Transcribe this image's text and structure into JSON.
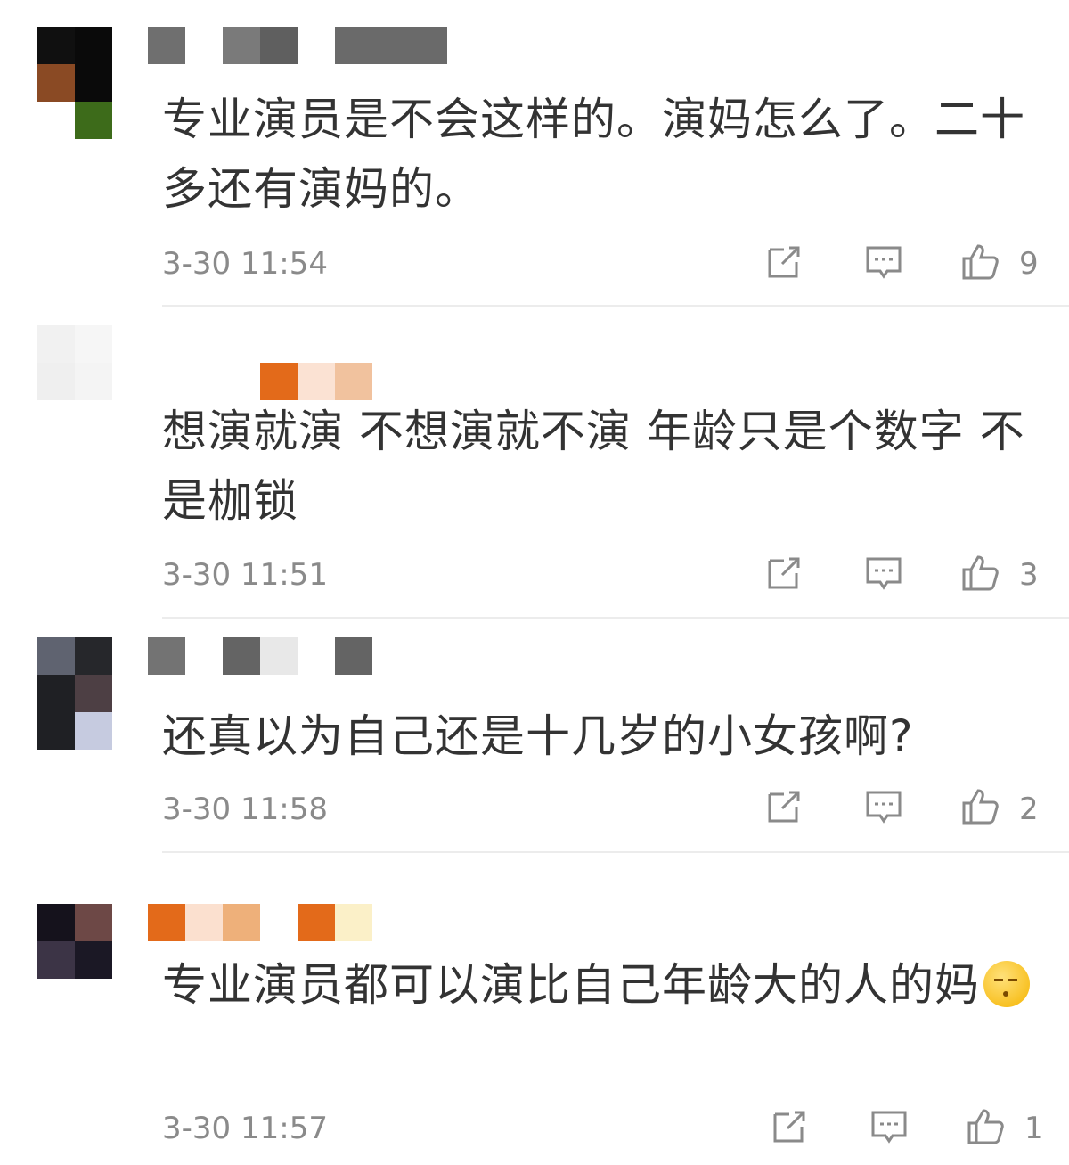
{
  "comments": [
    {
      "text": "专业演员是不会这样的。演妈怎么了。二十多还有演妈的。",
      "time": "3-30 11:54",
      "likes": "9",
      "avatar_colors": [
        "#101010",
        "#0a0a0a",
        "#8a4a24",
        "#3d6b1a"
      ],
      "username_colors": [
        "#6f6f6f",
        "#7a7a7a",
        "#5f5f5f",
        "#6a6a6a"
      ]
    },
    {
      "text": "想演就演 不想演就不演 年龄只是个数字 不是枷锁",
      "time": "3-30 11:51",
      "likes": "3",
      "avatar_colors": [
        "#f1f1f1",
        "#f6f6f6",
        "#efefef",
        "#f4f4f4"
      ],
      "username_colors": [
        "#e36a1a",
        "#fbe2d3",
        "#f1c29e"
      ]
    },
    {
      "text": "还真以为自己还是十几岁的小女孩啊?",
      "time": "3-30 11:58",
      "likes": "2",
      "avatar_colors": [
        "#5f6370",
        "#26272b",
        "#1f2024",
        "#4d3f44"
      ],
      "username_colors": [
        "#737373",
        "#646464",
        "#e8e8e8",
        "#646464"
      ]
    },
    {
      "text": "专业演员都可以演比自己年龄大的人的妈",
      "time": "3-30 11:57",
      "likes": "1",
      "avatar_colors": [
        "#15121c",
        "#6d4846",
        "#3c3446",
        "#1b1825"
      ],
      "username_colors": [
        "#e36a1a",
        "#fbe0cf",
        "#eeb07a",
        "#e36a1a",
        "#fbf0c8"
      ]
    }
  ],
  "icons": {
    "forward": "share-icon",
    "reply": "comment-icon",
    "like": "thumbs-up-icon"
  }
}
